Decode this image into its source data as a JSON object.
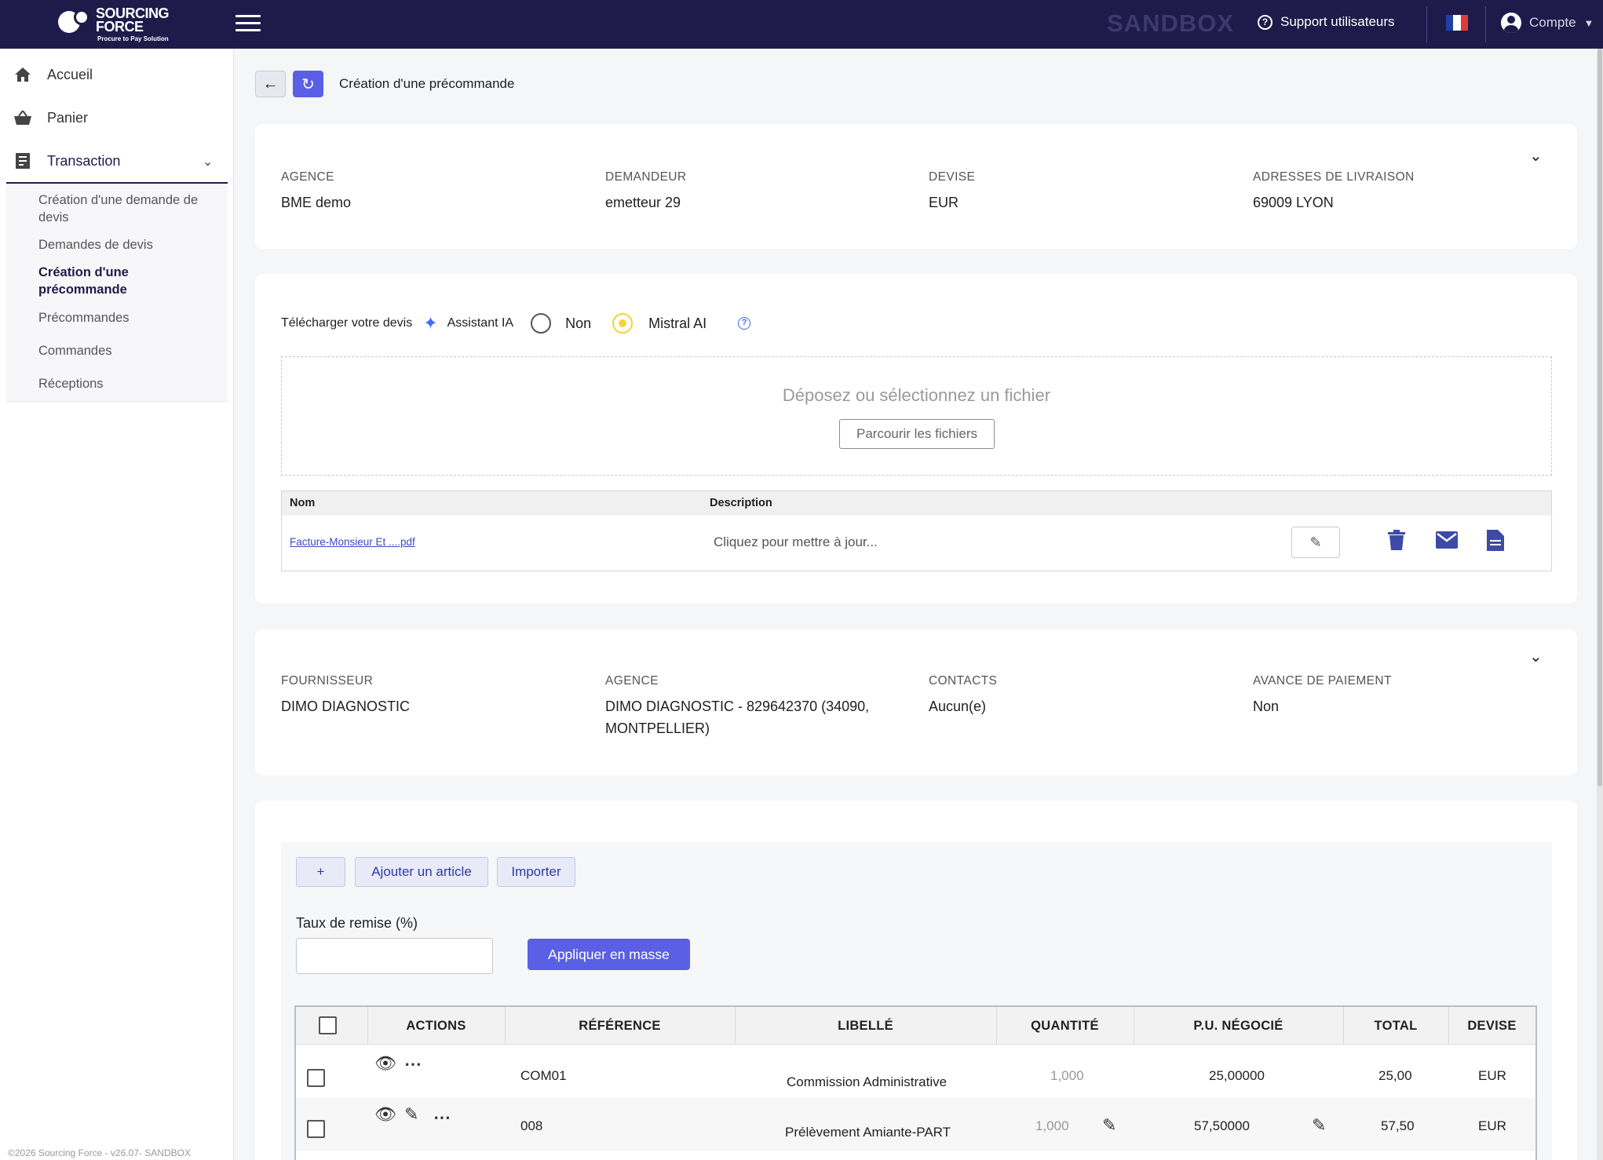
{
  "topbar": {
    "logo_line1": "SOURCING",
    "logo_line2": "FORCE",
    "logo_tagline": "Procure to Pay Solution",
    "environment": "SANDBOX",
    "support_label": "Support utilisateurs",
    "account_label": "Compte",
    "colors": {
      "bg": "#1e1b4b",
      "accent": "#5b5fe6"
    }
  },
  "sidebar": {
    "items": [
      {
        "label": "Accueil",
        "icon": "home-icon"
      },
      {
        "label": "Panier",
        "icon": "basket-icon"
      },
      {
        "label": "Transaction",
        "icon": "receipt-icon"
      }
    ],
    "subitems": [
      "Création d'une demande de devis",
      "Demandes de devis",
      "Création d'une précommande",
      "Précommandes",
      "Commandes",
      "Réceptions"
    ],
    "footer": "©2026 Sourcing Force - v26.07- SANDBOX"
  },
  "page": {
    "title": "Création d'une précommande"
  },
  "header_card": {
    "fields": [
      {
        "label": "AGENCE",
        "value": "BME demo"
      },
      {
        "label": "DEMANDEUR",
        "value": "emetteur 29"
      },
      {
        "label": "DEVISE",
        "value": "EUR"
      },
      {
        "label": "ADRESSES DE LIVRAISON",
        "value": "69009 LYON"
      }
    ]
  },
  "upload_card": {
    "download_label": "Télécharger votre devis",
    "assistant_label": "Assistant IA",
    "option_no": "Non",
    "option_ai": "Mistral AI",
    "selected_option": "Mistral AI",
    "dropzone_text": "Déposez ou sélectionnez un fichier",
    "browse_label": "Parcourir les fichiers",
    "table_headers": {
      "name": "Nom",
      "description": "Description"
    },
    "file": {
      "name": "Facture-Monsieur Et ....pdf",
      "description": "Cliquez pour mettre à jour..."
    }
  },
  "supplier_card": {
    "fields": [
      {
        "label": "FOURNISSEUR",
        "value": "DIMO DIAGNOSTIC"
      },
      {
        "label": "AGENCE",
        "value": "DIMO DIAGNOSTIC - 829642370 (34090, MONTPELLIER)"
      },
      {
        "label": "CONTACTS",
        "value": "Aucun(e)"
      },
      {
        "label": "AVANCE DE PAIEMENT",
        "value": "Non"
      }
    ]
  },
  "items_card": {
    "add_symbol": "+",
    "add_article_label": "Ajouter un article",
    "import_label": "Importer",
    "discount_label": "Taux de remise (%)",
    "discount_value": "",
    "apply_label": "Appliquer en masse",
    "columns": [
      "ACTIONS",
      "RÉFÉRENCE",
      "LIBELLÉ",
      "QUANTITÉ",
      "P.U. NÉGOCIÉ",
      "TOTAL",
      "DEVISE"
    ],
    "rows": [
      {
        "reference": "COM01",
        "label": "Commission Administrative",
        "quantity": "1,000",
        "unit_price": "25,00000",
        "total": "25,00",
        "currency": "EUR"
      },
      {
        "reference": "008",
        "label": "Prélèvement Amiante-PART",
        "quantity": "1,000",
        "unit_price": "57,50000",
        "total": "57,50",
        "currency": "EUR"
      }
    ]
  }
}
